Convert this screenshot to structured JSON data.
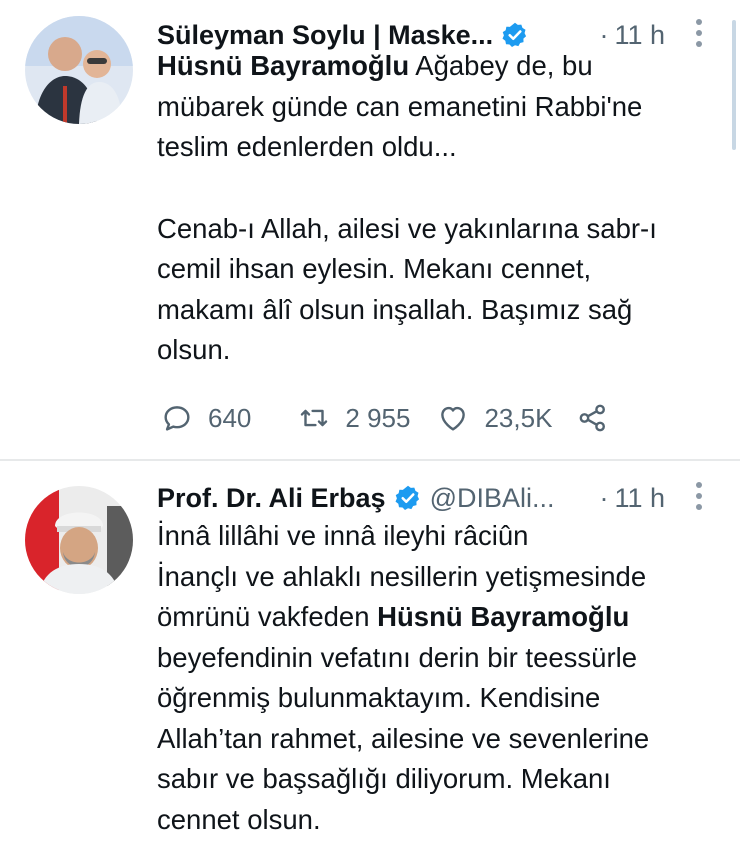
{
  "accent_color": "#1d9bf0",
  "tweets": [
    {
      "avatar": "avatar-photo",
      "name": "Süleyman Soylu | Maske...",
      "verified": true,
      "handle": "",
      "time_dot": "·",
      "time": "11 h",
      "mention": "Hüsnü Bayramoğlu",
      "text_line1_rest": " Ağabey de, bu",
      "text_line2": "mübarek günde can emanetini Rabbi'ne",
      "text_line3": "teslim edenlerden oldu...",
      "text_para2_line1": "Cenab-ı Allah, ailesi ve yakınlarına sabr-ı",
      "text_para2_line2": "cemil ihsan eylesin. Mekanı cennet,",
      "text_para2_line3": "makamı âlî olsun inşallah. Başımız sağ",
      "text_para2_line4": "olsun.",
      "replies": "640",
      "retweets": "2 955",
      "likes": "23,5K"
    },
    {
      "avatar": "avatar-photo",
      "name": "Prof. Dr. Ali Erbaş",
      "verified": true,
      "handle": "@DIBAli...",
      "time_dot": "·",
      "time": "11 h",
      "line1": "İnnâ lillâhi ve innâ ileyhi râciûn",
      "line2": "İnançlı ve ahlaklı nesillerin yetişmesinde",
      "line3_pre": "ömrünü vakfeden ",
      "line3_bold": "Hüsnü Bayramoğlu",
      "line4": "beyefendinin vefatını derin bir teessürle",
      "line5": "öğrenmiş bulunmaktayım. Kendisine",
      "line6": "Allah’tan rahmet, ailesine ve sevenlerine",
      "line7": "sabır ve başsağlığı diliyorum. Mekanı",
      "line8": "cennet olsun."
    }
  ]
}
